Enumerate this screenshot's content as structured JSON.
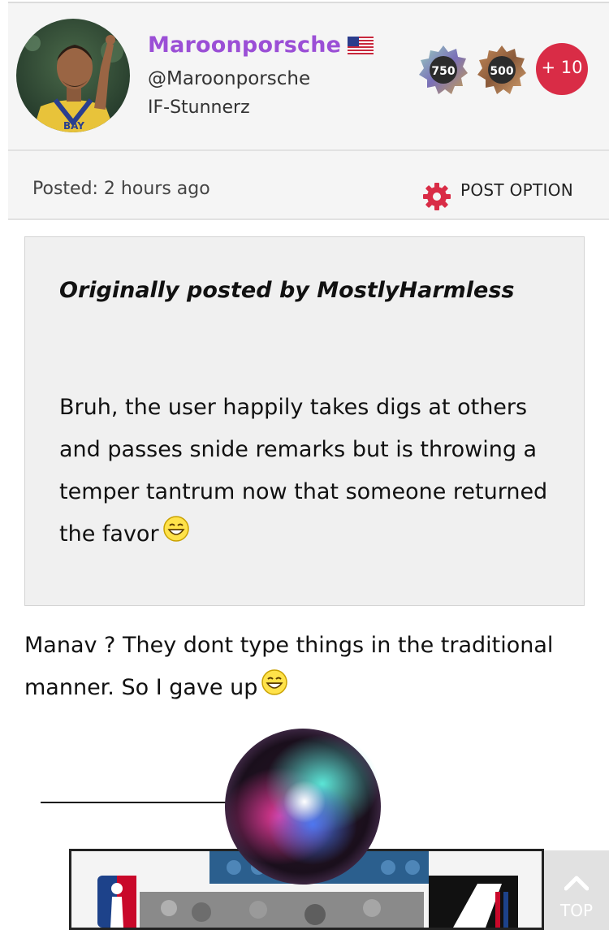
{
  "user": {
    "display_name": "Maroonporsche",
    "handle": "@Maroonporsche",
    "team": "IF-Stunnerz",
    "flag_icon": "us-flag-icon",
    "avatar_jersey_text": "BAY",
    "badges": [
      {
        "label": "750",
        "icon": "badge-750-icon"
      },
      {
        "label": "500",
        "icon": "badge-500-icon"
      }
    ],
    "extra_badges_label": "+ 10",
    "accent_color": "#9b4fd6"
  },
  "post": {
    "posted_label": "Posted: 2 hours ago",
    "option_label": "POST OPTION",
    "option_icon": "gear-icon",
    "option_color": "#d92c46"
  },
  "quote": {
    "author_line": "Originally posted by MostlyHarmless",
    "text": "Bruh, the user happily takes digs at others and passes snide remarks but is throwing a temper tantrum now that someone returned the favor"
  },
  "reply": {
    "text": "Manav ? They dont type things in the traditional manner. So I gave up"
  },
  "scroll_top": {
    "label": "TOP",
    "icon": "chevron-up-icon"
  }
}
